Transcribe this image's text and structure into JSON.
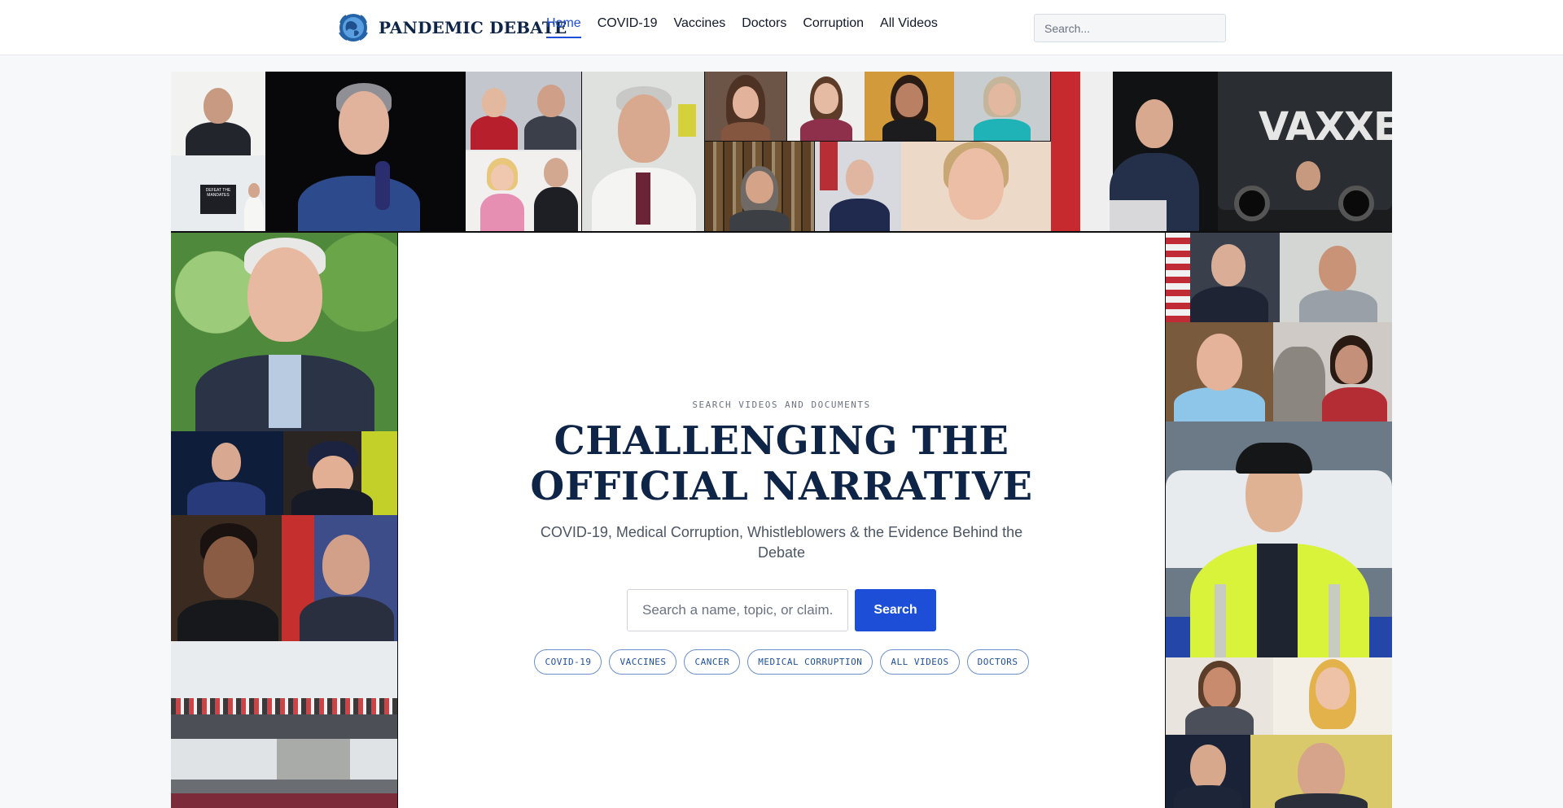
{
  "header": {
    "brand": "PANDEMIC DEBATE",
    "logo_icon": "globe-icon",
    "nav": [
      {
        "label": "Home",
        "active": true
      },
      {
        "label": "COVID-19",
        "active": false
      },
      {
        "label": "Vaccines",
        "active": false
      },
      {
        "label": "Doctors",
        "active": false
      },
      {
        "label": "Corruption",
        "active": false
      },
      {
        "label": "All Videos",
        "active": false
      }
    ],
    "search_placeholder": "Search..."
  },
  "collage": {
    "bus_text": "VAXXED",
    "sign_text": "DEFEAT THE MANDATES"
  },
  "hero": {
    "eyebrow": "SEARCH VIDEOS AND DOCUMENTS",
    "title": "CHALLENGING THE OFFICIAL NARRATIVE",
    "subtitle": "COVID-19, Medical Corruption, Whistleblowers & the Evidence Behind the Debate",
    "search_placeholder": "Search a name, topic, or claim.",
    "search_button": "Search",
    "chips": [
      "COVID-19",
      "VACCINES",
      "CANCER",
      "MEDICAL CORRUPTION",
      "ALL VIDEOS",
      "DOCTORS"
    ]
  },
  "colors": {
    "accent": "#1d4ed8",
    "brand_navy": "#0f2548",
    "chip_border": "#6b8fc9"
  }
}
